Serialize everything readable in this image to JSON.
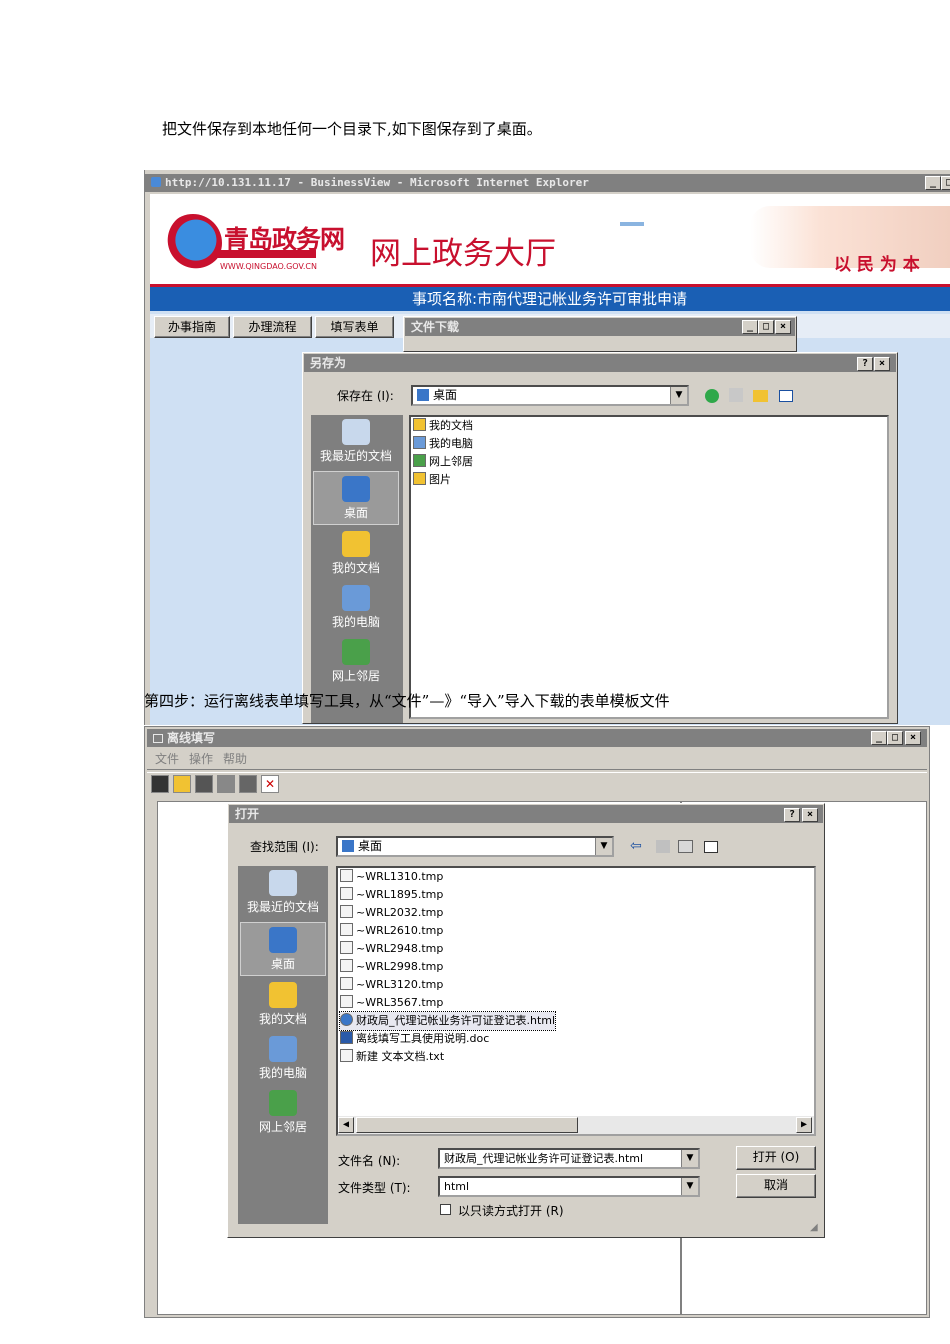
{
  "doc": {
    "intro": "把文件保存到本地任何一个目录下,如下图保存到了桌面。",
    "step4": "第四步：运行离线表单填写工具，从“文件”—》“导入”导入下载的表单模板文件"
  },
  "ie": {
    "title": "http://10.131.11.17 - BusinessView - Microsoft Internet Explorer",
    "logo_text": "青岛政务网",
    "logo_url": "WWW.QINGDAO.GOV.CN",
    "banner_title": "网上政务大厅",
    "slogan": "以 民 为 本",
    "item_bar": "事项名称:市南代理记帐业务许可审批申请",
    "tabs": [
      "办事指南",
      "办理流程",
      "填写表单"
    ]
  },
  "download": {
    "title": "文件下载"
  },
  "saveas": {
    "title": "另存为",
    "save_in_label": "保存在 (I):",
    "save_in_value": "桌面",
    "places": [
      "我最近的文档",
      "桌面",
      "我的文档",
      "我的电脑",
      "网上邻居"
    ],
    "files": [
      "我的文档",
      "我的电脑",
      "网上邻居",
      "图片"
    ]
  },
  "offline": {
    "title": "离线填写",
    "menu": [
      "文件",
      "操作",
      "帮助"
    ]
  },
  "open": {
    "title": "打开",
    "look_in_label": "查找范围 (I):",
    "look_in_value": "桌面",
    "places": [
      "我最近的文档",
      "桌面",
      "我的文档",
      "我的电脑",
      "网上邻居"
    ],
    "files": [
      "~WRL1310.tmp",
      "~WRL1895.tmp",
      "~WRL2032.tmp",
      "~WRL2610.tmp",
      "~WRL2948.tmp",
      "~WRL2998.tmp",
      "~WRL3120.tmp",
      "~WRL3567.tmp",
      "财政局_代理记帐业务许可证登记表.html",
      "离线填写工具使用说明.doc",
      "新建 文本文档.txt"
    ],
    "filename_label": "文件名 (N):",
    "filename_value": "财政局_代理记帐业务许可证登记表.html",
    "filetype_label": "文件类型 (T):",
    "filetype_value": "html",
    "open_button": "打开 (O)",
    "cancel_button": "取消",
    "readonly_label": "以只读方式打开 (R)"
  },
  "colors": {
    "ie_blue": "#1a5fb4",
    "banner_red": "#c8102e",
    "titlebar_gray": "#808080",
    "face": "#d4d0c8"
  }
}
